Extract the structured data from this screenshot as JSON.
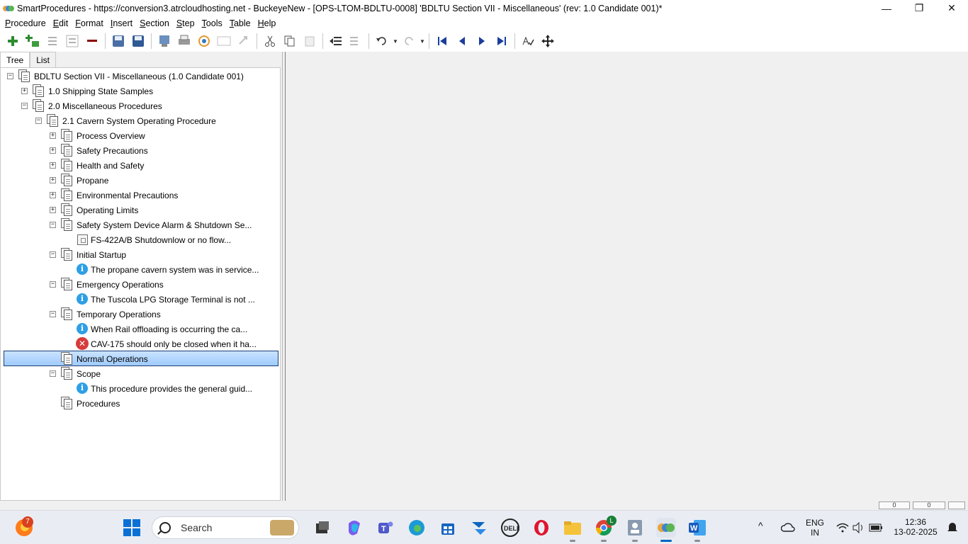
{
  "window": {
    "title": "SmartProcedures - https://conversion3.atrcloudhosting.net - BuckeyeNew - [OPS-LTOM-BDLTU-0008] 'BDLTU Section VII - Miscellaneous' (rev: 1.0 Candidate 001)*",
    "minimize": "—",
    "restore": "❐",
    "close": "✕"
  },
  "menu": [
    {
      "acc": "P",
      "rest": "rocedure"
    },
    {
      "acc": "E",
      "rest": "dit"
    },
    {
      "acc": "F",
      "rest": "ormat"
    },
    {
      "acc": "I",
      "rest": "nsert"
    },
    {
      "acc": "S",
      "rest": "ection"
    },
    {
      "acc": "S",
      "rest": "tep"
    },
    {
      "acc": "T",
      "rest": "ools"
    },
    {
      "acc": "T",
      "rest": "able"
    },
    {
      "acc": "H",
      "rest": "elp"
    }
  ],
  "toolbar": {
    "icons": [
      "add-icon",
      "add-child-icon",
      "indent-list-icon",
      "outdent-list-icon",
      "remove-icon",
      "save-all-icon",
      "save-icon",
      "publish-icon",
      "print-icon",
      "refresh-icon",
      "view-icon",
      "redo-icon",
      "cut-icon",
      "copy-icon",
      "paste-icon",
      "move-left-icon",
      "move-right-icon",
      "undo-icon",
      "redo-dropdown-icon",
      "first-icon",
      "previous-icon",
      "next-icon",
      "last-icon",
      "spell-check-icon",
      "move-icon"
    ]
  },
  "tabs": {
    "tree": "Tree",
    "list": "List"
  },
  "tree": {
    "items": [
      {
        "label": "BDLTU Section VII - Miscellaneous (1.0 Candidate 001)",
        "expander": "−",
        "icon": "document-icon"
      },
      {
        "label": "1.0 Shipping State Samples",
        "expander": "+",
        "icon": "document-icon"
      },
      {
        "label": "2.0 Miscellaneous Procedures",
        "expander": "−",
        "icon": "document-icon"
      },
      {
        "label": "2.1 Cavern System Operating Procedure",
        "expander": "−",
        "icon": "document-icon"
      },
      {
        "label": "Process Overview",
        "expander": "+",
        "icon": "document-icon"
      },
      {
        "label": "Safety Precautions",
        "expander": "+",
        "icon": "document-icon"
      },
      {
        "label": "Health and Safety",
        "expander": "+",
        "icon": "document-icon"
      },
      {
        "label": "Propane",
        "expander": "+",
        "icon": "document-icon"
      },
      {
        "label": "Environmental Precautions",
        "expander": "+",
        "icon": "document-icon"
      },
      {
        "label": "Operating Limits",
        "expander": "+",
        "icon": "document-icon"
      },
      {
        "label": "Safety System Device Alarm & Shutdown Se...",
        "expander": "−",
        "icon": "document-icon"
      },
      {
        "label": "FS-422A/B Shutdownlow or no flow...",
        "expander": "",
        "icon": "image-icon"
      },
      {
        "label": "Initial Startup",
        "expander": "−",
        "icon": "document-icon"
      },
      {
        "label": "The propane cavern system was in service...",
        "expander": "",
        "icon": "info-icon"
      },
      {
        "label": "Emergency Operations",
        "expander": "−",
        "icon": "document-icon"
      },
      {
        "label": "The Tuscola LPG Storage Terminal is not ...",
        "expander": "",
        "icon": "info-icon"
      },
      {
        "label": "Temporary Operations",
        "expander": "−",
        "icon": "document-icon"
      },
      {
        "label": "When Rail offloading is occurring the ca...",
        "expander": "",
        "icon": "info-icon"
      },
      {
        "label": "CAV-175 should only be closed when it ha...",
        "expander": "",
        "icon": "error-icon"
      },
      {
        "label": "Normal Operations",
        "expander": "",
        "icon": "document-icon"
      },
      {
        "label": "Scope",
        "expander": "−",
        "icon": "document-icon"
      },
      {
        "label": "This procedure provides the general guid...",
        "expander": "",
        "icon": "info-icon"
      },
      {
        "label": "Procedures",
        "expander": "",
        "icon": "document-icon"
      }
    ],
    "selected": "Normal Operations"
  },
  "statusbar": {
    "box1": "0",
    "box2": "0"
  },
  "taskbar": {
    "notification_count": "7",
    "search_placeholder": "Search",
    "chrome_badge": "L",
    "language": "ENG",
    "region": "IN",
    "time": "12:36",
    "date": "13-02-2025",
    "chevron": "^"
  }
}
